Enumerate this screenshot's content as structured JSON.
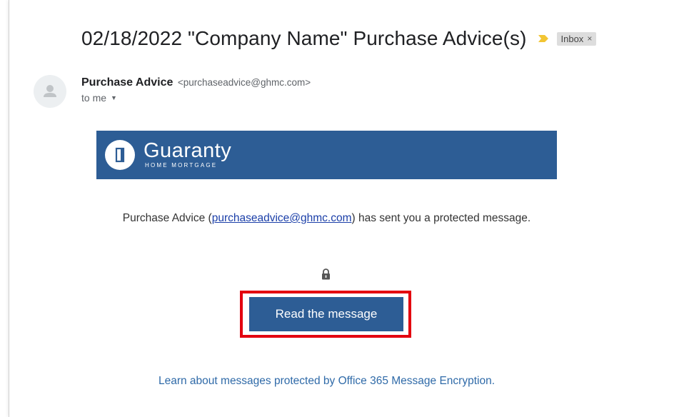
{
  "email": {
    "subject": "02/18/2022 \"Company Name\" Purchase Advice(s)",
    "label": "Inbox",
    "label_remove": "×",
    "sender_name": "Purchase Advice",
    "sender_email": "<purchaseadvice@ghmc.com>",
    "recipient": "to me"
  },
  "body": {
    "logo_text": "Guaranty",
    "logo_subtext": "HOME MORTGAGE",
    "notice_prefix": "Purchase Advice (",
    "notice_link": "purchaseadvice@ghmc.com",
    "notice_suffix": ") has sent you a protected message.",
    "button_label": "Read the message",
    "learn_link": "Learn about messages protected by Office 365 Message Encryption."
  },
  "colors": {
    "brand_blue": "#2d5d95",
    "highlight_red": "#e3000f",
    "importance_yellow": "#f2c533"
  },
  "icons": {
    "avatar": "default-person-icon",
    "importance": "importance-marker-icon",
    "caret": "caret-down-icon",
    "lock": "lock-icon"
  }
}
